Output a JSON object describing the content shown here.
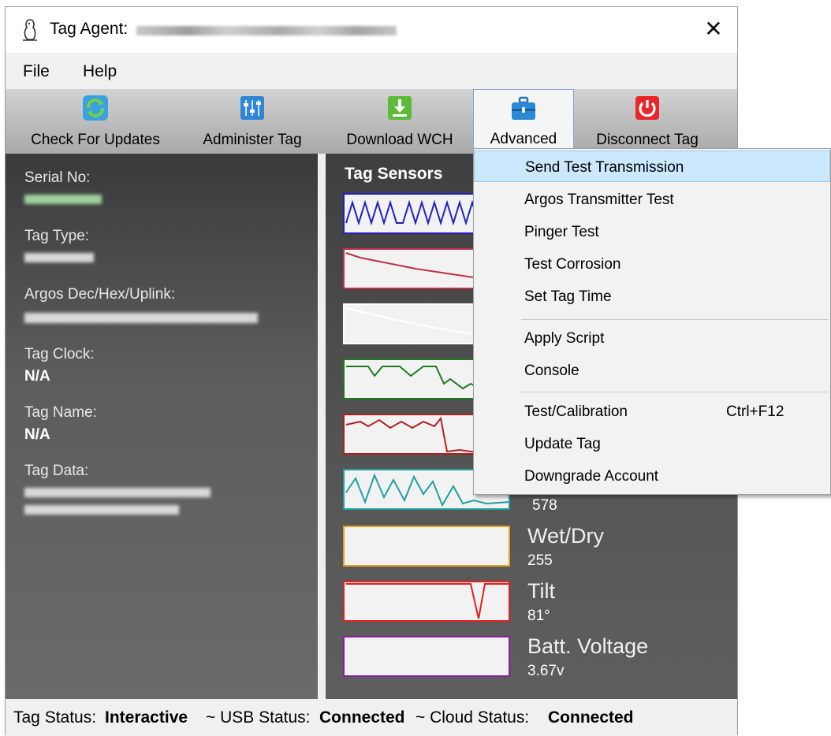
{
  "window": {
    "title": "Tag Agent:",
    "close_glyph": "✕"
  },
  "menubar": {
    "file": "File",
    "help": "Help"
  },
  "toolbar": {
    "check_updates": "Check For Updates",
    "administer_tag": "Administer Tag",
    "download_wch": "Download WCH",
    "advanced": "Advanced",
    "disconnect_tag": "Disconnect Tag"
  },
  "left_panel": {
    "serial_label": "Serial No:",
    "tag_type_label": "Tag Type:",
    "argos_label": "Argos Dec/Hex/Uplink:",
    "tag_clock_label": "Tag Clock:",
    "tag_clock_value": "N/A",
    "tag_name_label": "Tag Name:",
    "tag_name_value": "N/A",
    "tag_data_label": "Tag Data:"
  },
  "sensors": {
    "title": "Tag Sensors",
    "partial_value": "578",
    "wetdry_name": "Wet/Dry",
    "wetdry_value": "255",
    "tilt_name": "Tilt",
    "tilt_value": "81°",
    "batt_name": "Batt. Voltage",
    "batt_value": "3.67v",
    "colors": [
      "#2020c0",
      "#c0304a",
      "#ffffff",
      "#1e7a1e",
      "#b02020",
      "#20a0a0",
      "#e8a020",
      "#e02020",
      "#8a20a0"
    ]
  },
  "dropdown": {
    "send_test": "Send Test Transmission",
    "argos_test": "Argos Transmitter Test",
    "pinger_test": "Pinger Test",
    "test_corrosion": "Test Corrosion",
    "set_tag_time": "Set Tag Time",
    "apply_script": "Apply Script",
    "console": "Console",
    "test_calibration": "Test/Calibration",
    "test_calibration_shortcut": "Ctrl+F12",
    "update_tag": "Update Tag",
    "downgrade_account": "Downgrade Account"
  },
  "statusbar": {
    "tag_status_label": "Tag Status:",
    "tag_status_value": "Interactive",
    "usb_label": "~ USB Status:",
    "usb_value": "Connected",
    "cloud_label": "~ Cloud Status:",
    "cloud_value": "Connected"
  }
}
